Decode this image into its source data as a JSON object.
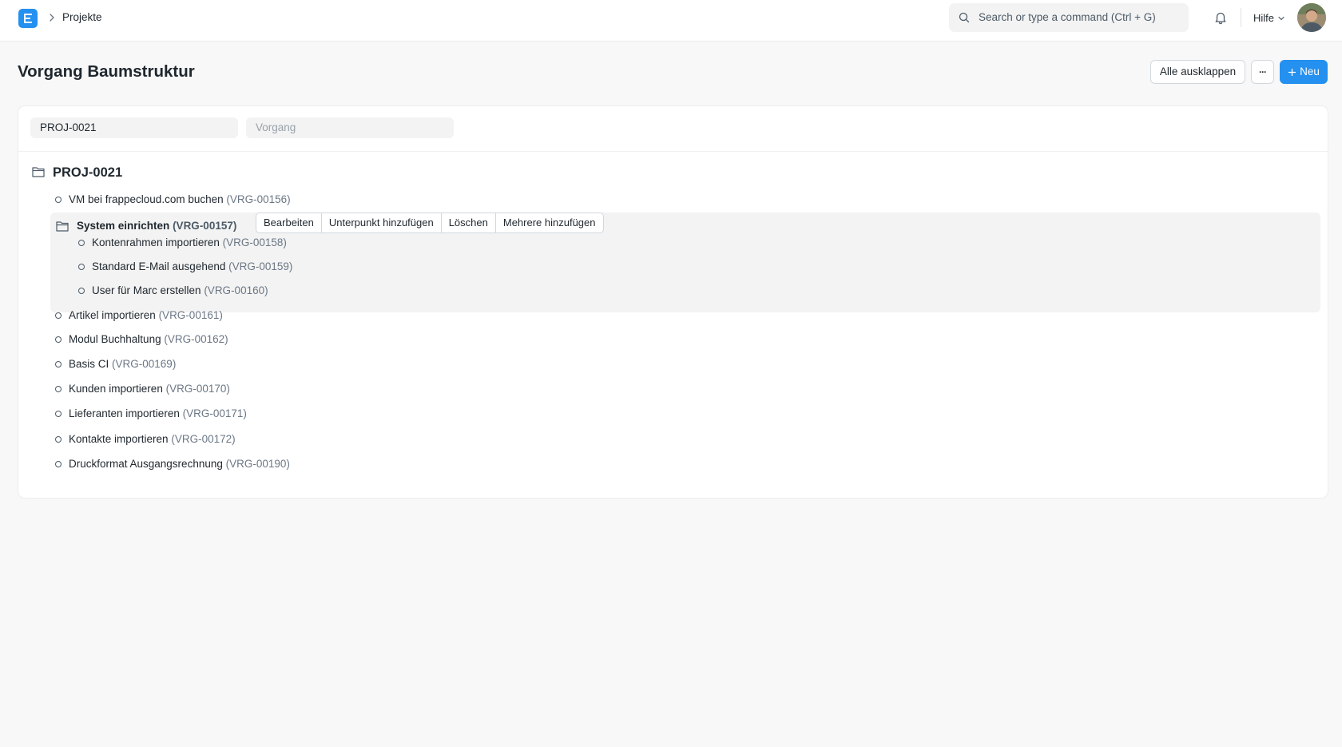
{
  "navbar": {
    "logo_letter": "E",
    "breadcrumb": "Projekte",
    "search_placeholder": "Search or type a command (Ctrl + G)",
    "help_label": "Hilfe"
  },
  "page": {
    "title": "Vorgang Baumstruktur",
    "expand_all_label": "Alle ausklappen",
    "more_label": "···",
    "new_label": "Neu"
  },
  "filters": {
    "project_value": "PROJ-0021",
    "task_placeholder": "Vorgang"
  },
  "tree": {
    "root_label": "PROJ-0021",
    "selected": {
      "name": "System einrichten",
      "id": "(VRG-00157)",
      "actions": [
        "Bearbeiten",
        "Unterpunkt hinzufügen",
        "Löschen",
        "Mehrere hinzufügen"
      ]
    },
    "nodes": [
      {
        "name": "VM bei frappecloud.com buchen",
        "id": "(VRG-00156)"
      },
      {
        "name": "Kontenrahmen importieren",
        "id": "(VRG-00158)"
      },
      {
        "name": "Standard E-Mail ausgehend",
        "id": "(VRG-00159)"
      },
      {
        "name": "User für Marc erstellen",
        "id": "(VRG-00160)"
      },
      {
        "name": "Artikel importieren",
        "id": "(VRG-00161)"
      },
      {
        "name": "Modul Buchhaltung",
        "id": "(VRG-00162)"
      },
      {
        "name": "Basis CI",
        "id": "(VRG-00169)"
      },
      {
        "name": "Kunden importieren",
        "id": "(VRG-00170)"
      },
      {
        "name": "Lieferanten importieren",
        "id": "(VRG-00171)"
      },
      {
        "name": "Kontakte importieren",
        "id": "(VRG-00172)"
      },
      {
        "name": "Druckformat Ausgangsrechnung",
        "id": "(VRG-00190)"
      }
    ]
  },
  "colors": {
    "primary": "#2490ef",
    "selected_bg": "#f3f3f3",
    "muted_text": "#6b7785"
  }
}
